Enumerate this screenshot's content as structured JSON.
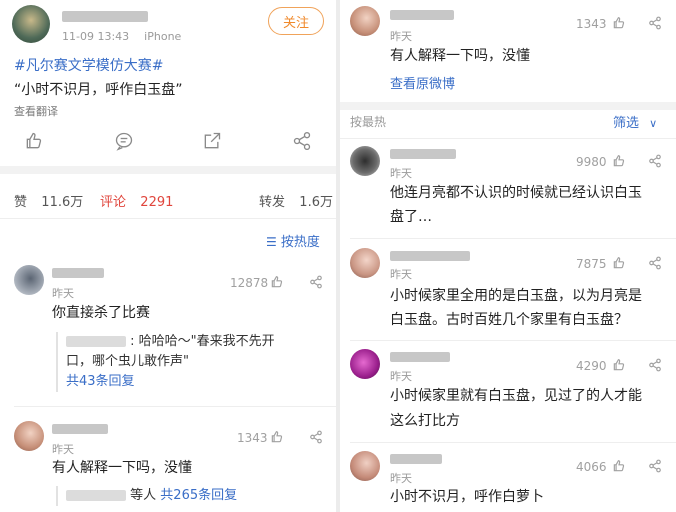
{
  "post": {
    "timestamp": "11-09 13:43",
    "device": "iPhone",
    "follow_label": "关注",
    "hashtag": "#凡尔赛文学模仿大赛#",
    "text": "“小时不识月，呼作白玉盘”",
    "translate_label": "查看翻译"
  },
  "stats": {
    "likes_label": "赞",
    "likes": "11.6万",
    "comments_label": "评论",
    "comments": "2291",
    "reposts_label": "转发",
    "reposts": "1.6万"
  },
  "sort_hot_label": "按热度",
  "left_comments": [
    {
      "time": "昨天",
      "likes": "12878",
      "text": "你直接杀了比赛",
      "reply_text_1": ": 哈哈哈～\"春来我不先开",
      "reply_text_2": "口，哪个虫儿敢作声\"",
      "reply_more": "共43条回复"
    },
    {
      "time": "昨天",
      "likes": "1343",
      "text": "有人解释一下吗，没懂",
      "reply_prefix": "等人",
      "reply_more": "共265条回复"
    }
  ],
  "right_top": {
    "time": "昨天",
    "likes": "1343",
    "text": "有人解释一下吗，没懂",
    "view_original": "查看原微博"
  },
  "right_header": {
    "sort_label": "按最热",
    "filter_label": "筛选"
  },
  "right_comments": [
    {
      "time": "昨天",
      "likes": "9980",
      "line1": "他连月亮都不认识的时候就已经认识白玉",
      "line2": "盘了…"
    },
    {
      "time": "昨天",
      "likes": "7875",
      "line1": "小时候家里全用的是白玉盘，以为月亮是",
      "line2": "白玉盘。古时百姓几个家里有白玉盘？"
    },
    {
      "time": "昨天",
      "likes": "4290",
      "line1": "小时候家里就有白玉盘，见过了的人才能",
      "line2": "这么打比方"
    },
    {
      "time": "昨天",
      "likes": "4066",
      "line1": "小时不识月，呼作白萝卜",
      "line2": ""
    }
  ],
  "colors": {
    "accent_orange": "#f08a2c",
    "comment_red": "#e0453c",
    "link_blue": "#3a6ec7"
  }
}
